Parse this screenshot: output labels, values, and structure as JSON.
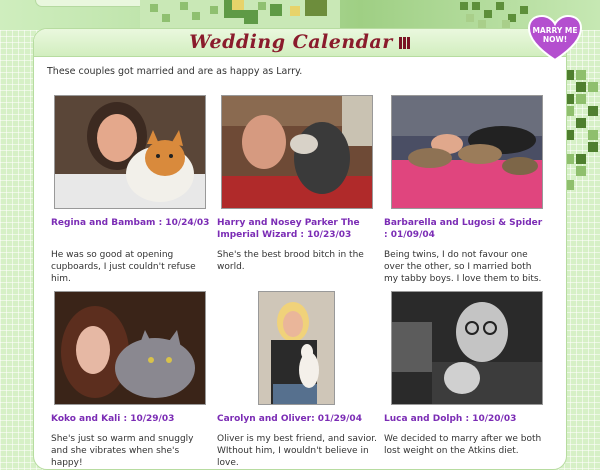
{
  "header": {
    "title": "Wedding Calendar",
    "intro": "These couples got married and are as happy as Larry."
  },
  "badge": {
    "label_line1": "MARRY ME",
    "label_line2": "NOW!"
  },
  "couples": [
    {
      "caption": "Regina and Bambam : 10/24/03",
      "description": "He was so good at opening cupboards, I just couldn't refuse him."
    },
    {
      "caption": "Harry and Nosey Parker The Imperial Wizard : 10/23/03",
      "description": "She's the best brood bitch in the world."
    },
    {
      "caption": "Barbarella and Lugosi & Spider : 01/09/04",
      "description": "Being twins, I do not favour one over the other, so I married both my tabby boys. I love them to bits."
    },
    {
      "caption": "Koko and Kali : 10/29/03",
      "description": "She's just so warm and snuggly and she vibrates when she's happy!"
    },
    {
      "caption": "Carolyn and Oliver: 01/29/04",
      "description": "Oliver is my best friend, and savior. WIthout him, I wouldn't believe in love."
    },
    {
      "caption": "Luca and Dolph : 10/20/03",
      "description": "We decided to marry after we both lost weight on the Atkins diet."
    }
  ],
  "colors": {
    "title": "#8a1b2c",
    "caption": "#7b2cb5",
    "badge": "#b44fcf",
    "background": "#d6f0c6"
  }
}
